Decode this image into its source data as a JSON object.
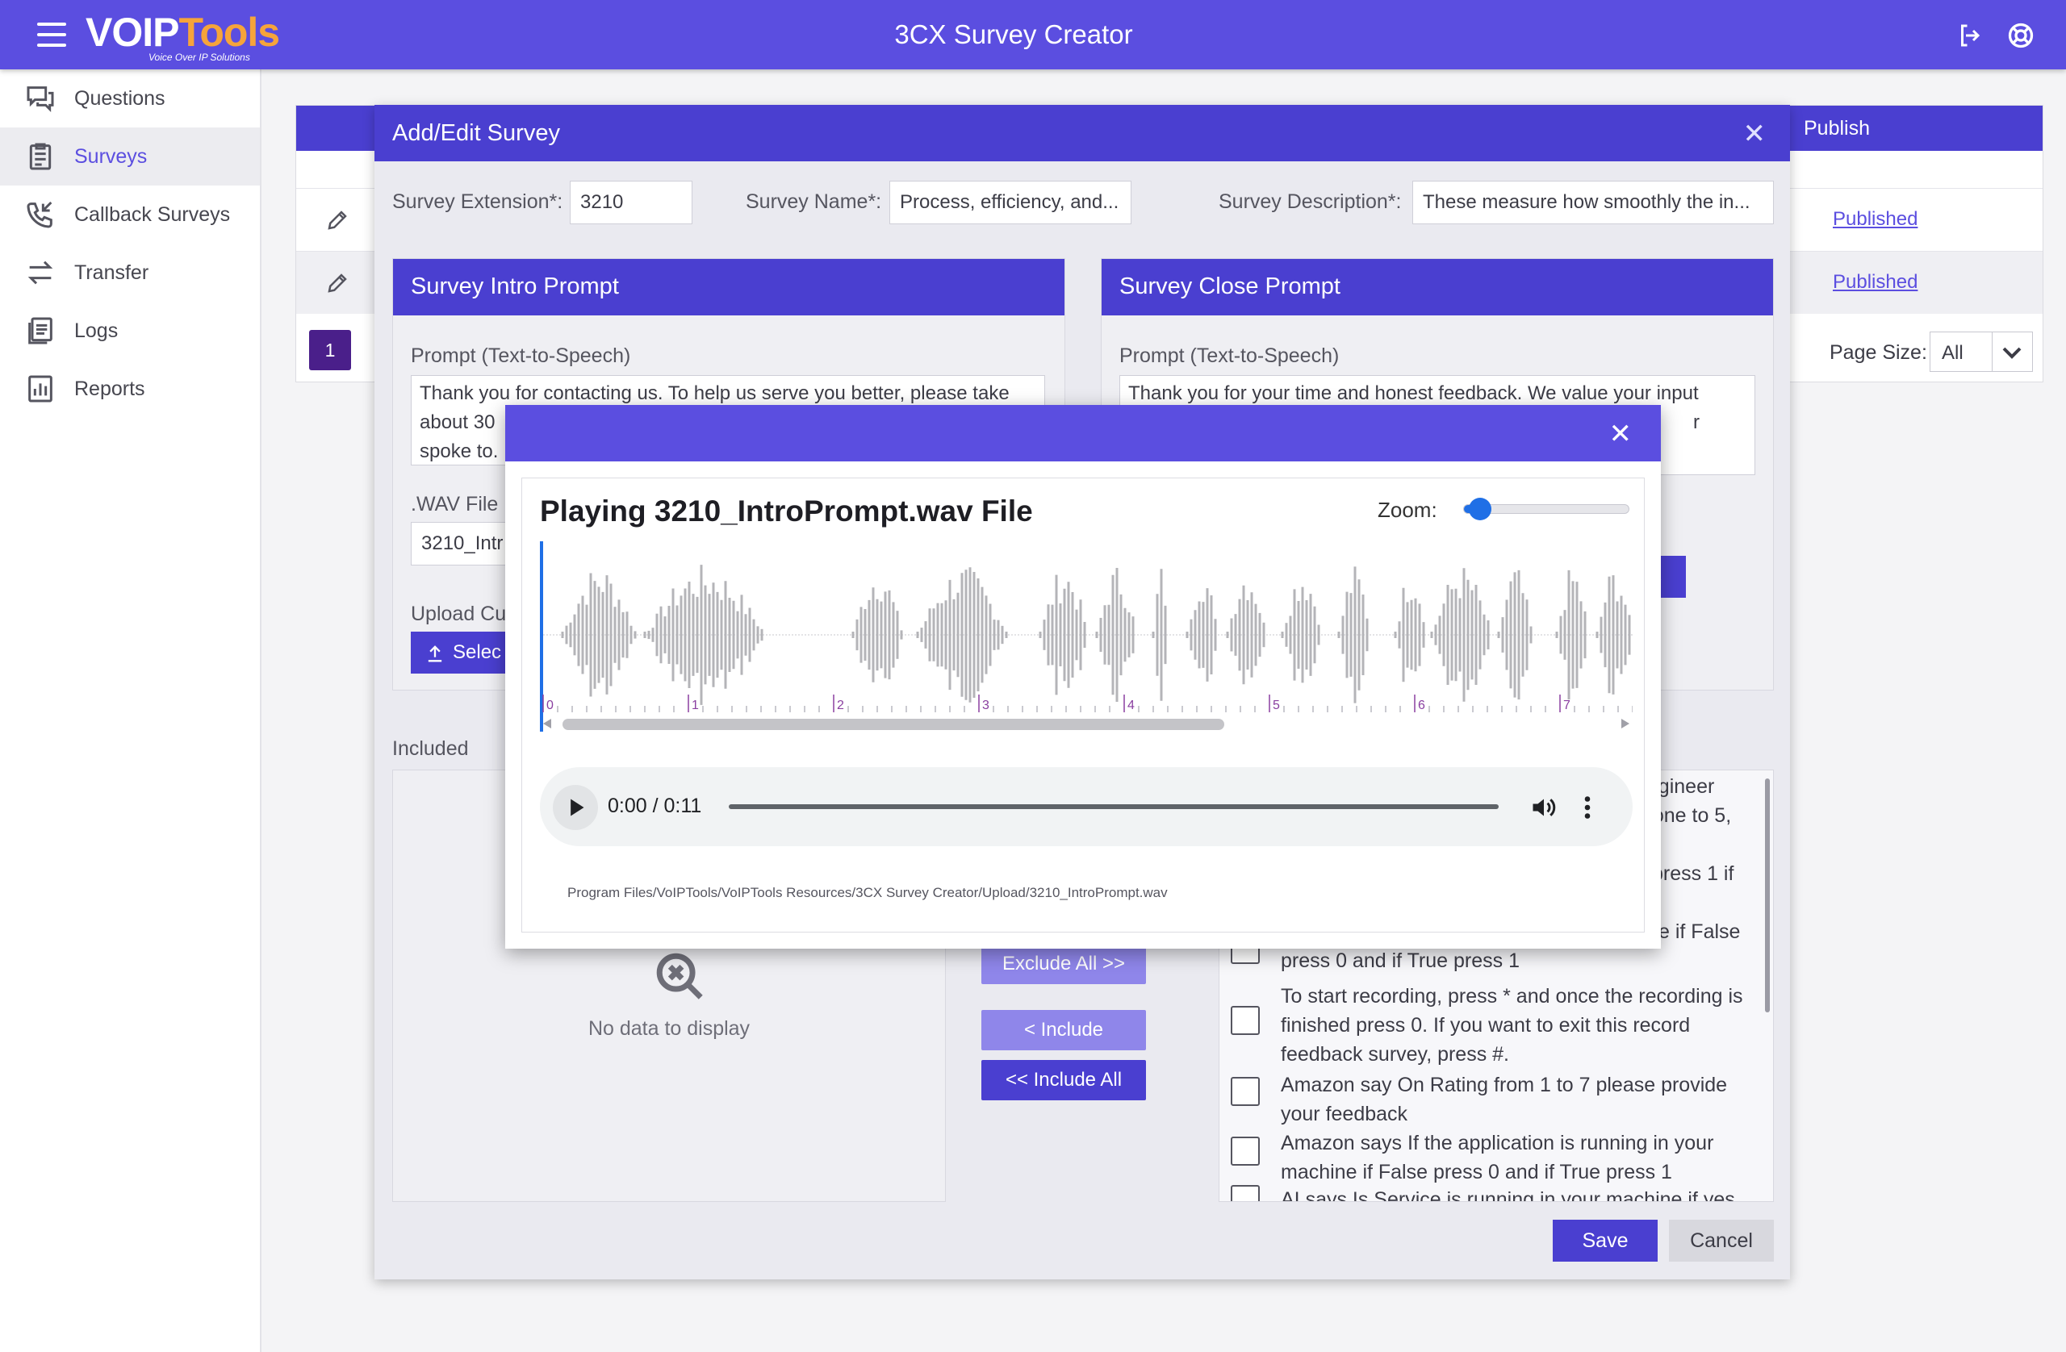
{
  "header": {
    "brand_main": "VOIP",
    "brand_accent": "Tools",
    "brand_tagline": "Voice Over IP Solutions",
    "title": "3CX Survey Creator"
  },
  "sidebar": {
    "items": [
      {
        "label": "Questions",
        "icon": "questions-icon"
      },
      {
        "label": "Surveys",
        "icon": "surveys-icon",
        "active": true
      },
      {
        "label": "Callback Surveys",
        "icon": "callback-icon"
      },
      {
        "label": "Transfer",
        "icon": "transfer-icon"
      },
      {
        "label": "Logs",
        "icon": "logs-icon"
      },
      {
        "label": "Reports",
        "icon": "reports-icon"
      }
    ]
  },
  "background_table": {
    "publish_header": "Publish",
    "rows": [
      {
        "status": "Published"
      },
      {
        "status": "Published"
      }
    ],
    "current_page": "1",
    "page_size_label": "Page Size:",
    "page_size_value": "All"
  },
  "edit_dialog": {
    "title": "Add/Edit Survey",
    "extension_label": "Survey Extension*:",
    "extension_value": "3210",
    "name_label": "Survey Name*:",
    "name_value": "Process, efficiency, and...",
    "description_label": "Survey Description*:",
    "description_value": "These measure how smoothly the in...",
    "intro": {
      "title": "Survey Intro Prompt",
      "prompt_label": "Prompt (Text-to-Speech)",
      "prompt_line1": "Thank you for contacting us. To help us serve you better, please take",
      "prompt_line2": "about 30",
      "prompt_line3": "spoke to.",
      "wav_label": ".WAV File",
      "wav_value": "3210_Intr",
      "upload_label": "Upload Cu",
      "upload_button": "Selec"
    },
    "close": {
      "title": "Survey Close Prompt",
      "prompt_label": "Prompt (Text-to-Speech)",
      "prompt_line1": "Thank you for your time and honest feedback. We value your input",
      "prompt_line2": "r"
    },
    "included_label": "Included",
    "no_data": "No data to display",
    "exclude_all": "Exclude All >>",
    "include": "< Include",
    "include_all": "<< Include All",
    "available_items": [
      {
        "text": "engineer"
      },
      {
        "text": "n one to 5,"
      },
      {
        "text": "press 1 if"
      },
      {
        "text": "e if False"
      },
      {
        "text": "press 0 and if True press 1"
      },
      {
        "text": "To start recording, press * and once the recording is finished press 0. If you want to exit this record feedback survey, press #."
      },
      {
        "text": "Amazon say On Rating from 1 to 7 please provide your feedback"
      },
      {
        "text": "Amazon says If the application is running in your machine if False press 0 and if True press 1"
      },
      {
        "text": "AI says Is Service is running in your machine if yes"
      }
    ],
    "save": "Save",
    "cancel": "Cancel"
  },
  "player": {
    "title": "Playing 3210_IntroPrompt.wav File",
    "zoom_label": "Zoom:",
    "zoom_level": 0.1,
    "timeline_ticks": [
      "0",
      "1",
      "2",
      "3",
      "4",
      "5",
      "6",
      "7"
    ],
    "time": "0:00 / 0:11",
    "file_path": "Program Files/VoIPTools/VoIPTools Resources/3CX Survey Creator/Upload/3210_IntroPrompt.wav",
    "waveform_color": "#b4b4b8",
    "cursor_color": "#1f6fe6",
    "tick_color": "#8a3fa0"
  },
  "colors": {
    "primary": "#5b4ee0",
    "header_dark": "#4a3fd0",
    "accent_orange": "#f6a43a"
  }
}
